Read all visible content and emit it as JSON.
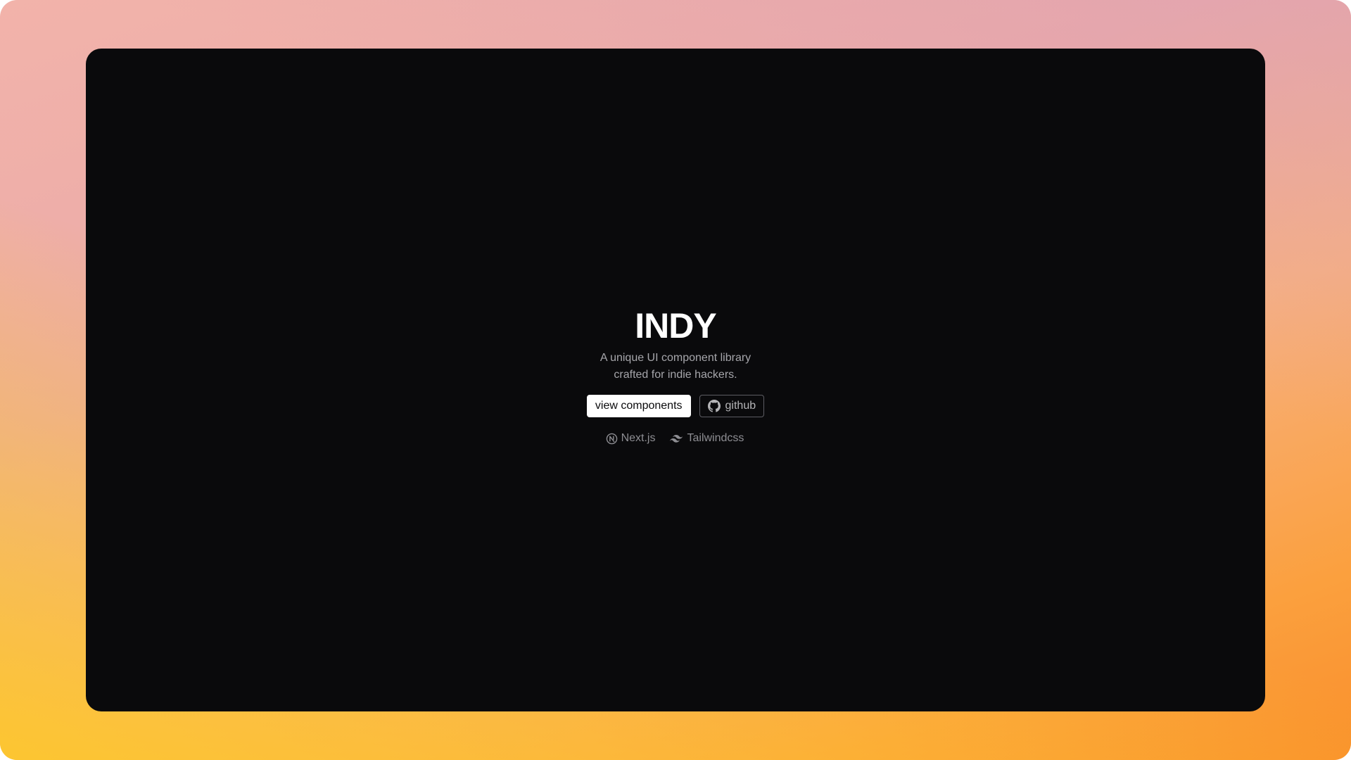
{
  "hero": {
    "title": "INDY",
    "subtitle_line1": "A unique UI component library",
    "subtitle_line2": "crafted for indie hackers."
  },
  "actions": {
    "primary_label": "view components",
    "secondary_label": "github",
    "secondary_icon": "github-icon"
  },
  "stack": [
    {
      "label": "Next.js",
      "icon": "nextjs-icon"
    },
    {
      "label": "Tailwindcss",
      "icon": "tailwind-icon"
    }
  ],
  "colors": {
    "window_bg": "#0a0a0c",
    "primary_button_bg": "#ffffff",
    "text_muted": "#a6a6ab"
  }
}
